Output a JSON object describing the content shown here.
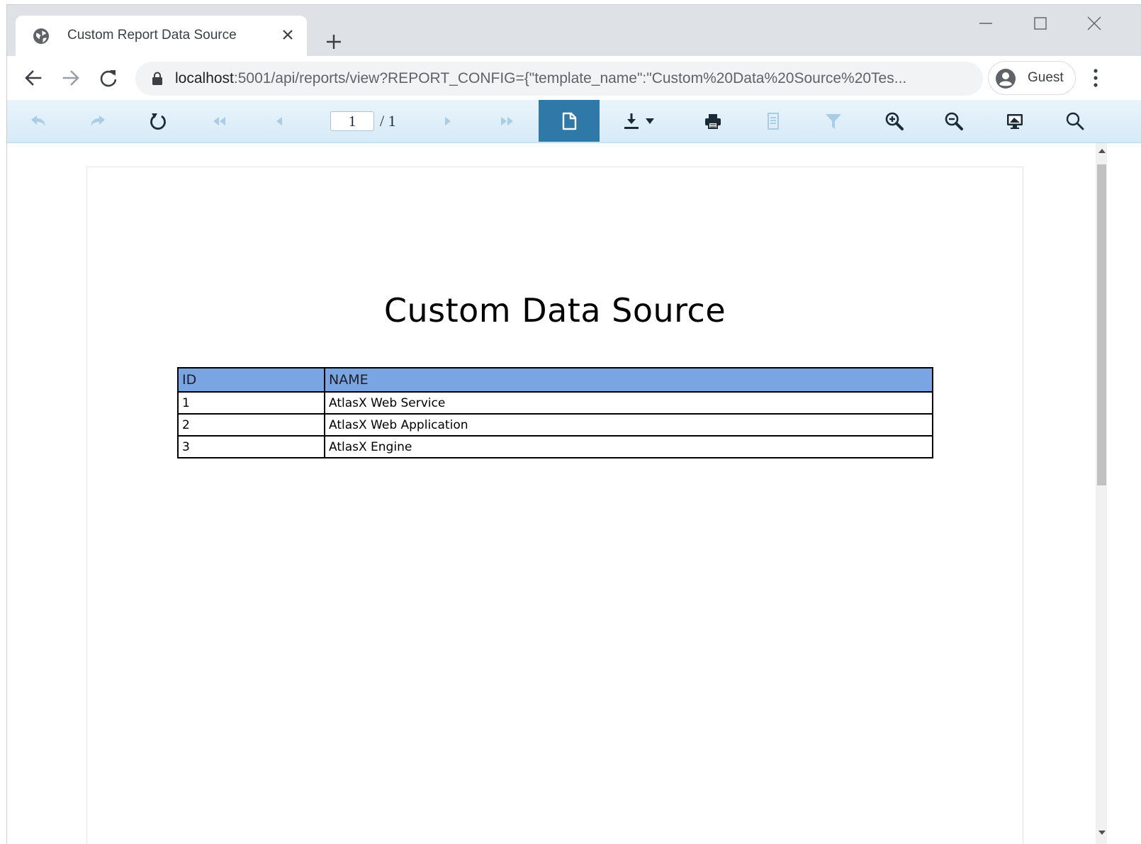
{
  "browser": {
    "tab": {
      "title": "Custom Report Data Source"
    },
    "address": {
      "host": "localhost",
      "rest": ":5001/api/reports/view?REPORT_CONFIG={\"template_name\":\"Custom%20Data%20Source%20Tes..."
    },
    "profile": {
      "name": "Guest"
    }
  },
  "viewer": {
    "page_input": "1",
    "page_total": "/ 1"
  },
  "report": {
    "title": "Custom Data Source",
    "columns": [
      "ID",
      "NAME"
    ],
    "rows": [
      [
        "1",
        "AtlasX Web Service"
      ],
      [
        "2",
        "AtlasX Web Application"
      ],
      [
        "3",
        "AtlasX Engine"
      ]
    ],
    "header_color": "#79a5e3"
  },
  "theme": {
    "viewer_active": "#2e79a8",
    "viewer_icon_enabled": "#1b2a36",
    "viewer_icon_disabled": "#a9cde4"
  }
}
